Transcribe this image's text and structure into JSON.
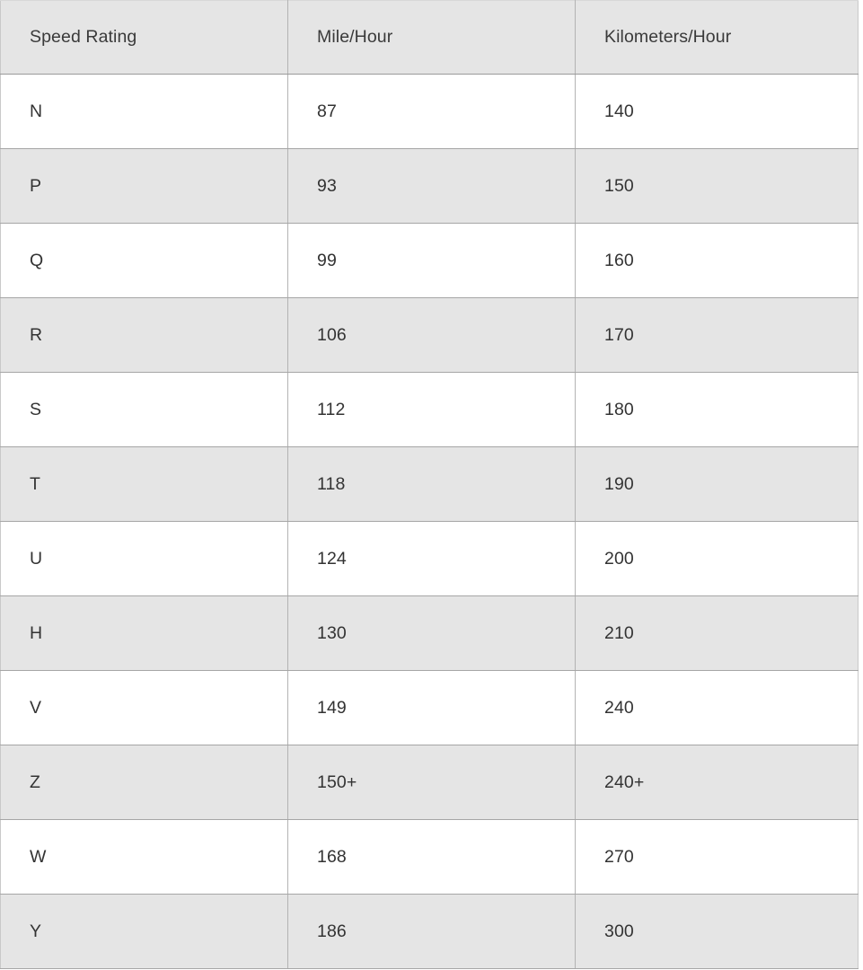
{
  "table": {
    "columns": [
      {
        "key": "rating",
        "label": "Speed Rating"
      },
      {
        "key": "mph",
        "label": "Mile/Hour"
      },
      {
        "key": "kph",
        "label": "Kilometers/Hour"
      }
    ],
    "rows": [
      {
        "rating": "N",
        "mph": "87",
        "kph": "140"
      },
      {
        "rating": "P",
        "mph": "93",
        "kph": "150"
      },
      {
        "rating": "Q",
        "mph": "99",
        "kph": "160"
      },
      {
        "rating": "R",
        "mph": "106",
        "kph": "170"
      },
      {
        "rating": "S",
        "mph": "112",
        "kph": "180"
      },
      {
        "rating": "T",
        "mph": "118",
        "kph": "190"
      },
      {
        "rating": "U",
        "mph": "124",
        "kph": "200"
      },
      {
        "rating": "H",
        "mph": "130",
        "kph": "210"
      },
      {
        "rating": "V",
        "mph": "149",
        "kph": "240"
      },
      {
        "rating": "Z",
        "mph": "150+",
        "kph": "240+"
      },
      {
        "rating": "W",
        "mph": "168",
        "kph": "270"
      },
      {
        "rating": "Y",
        "mph": "186",
        "kph": "300"
      }
    ],
    "colors": {
      "header_background": "#e5e5e5",
      "row_shaded_background": "#e5e5e5",
      "row_plain_background": "#ffffff",
      "text": "#333333",
      "header_text": "#3a3a3a",
      "border": "#b3b3b3",
      "header_border_bottom": "#9a9a9a"
    }
  }
}
